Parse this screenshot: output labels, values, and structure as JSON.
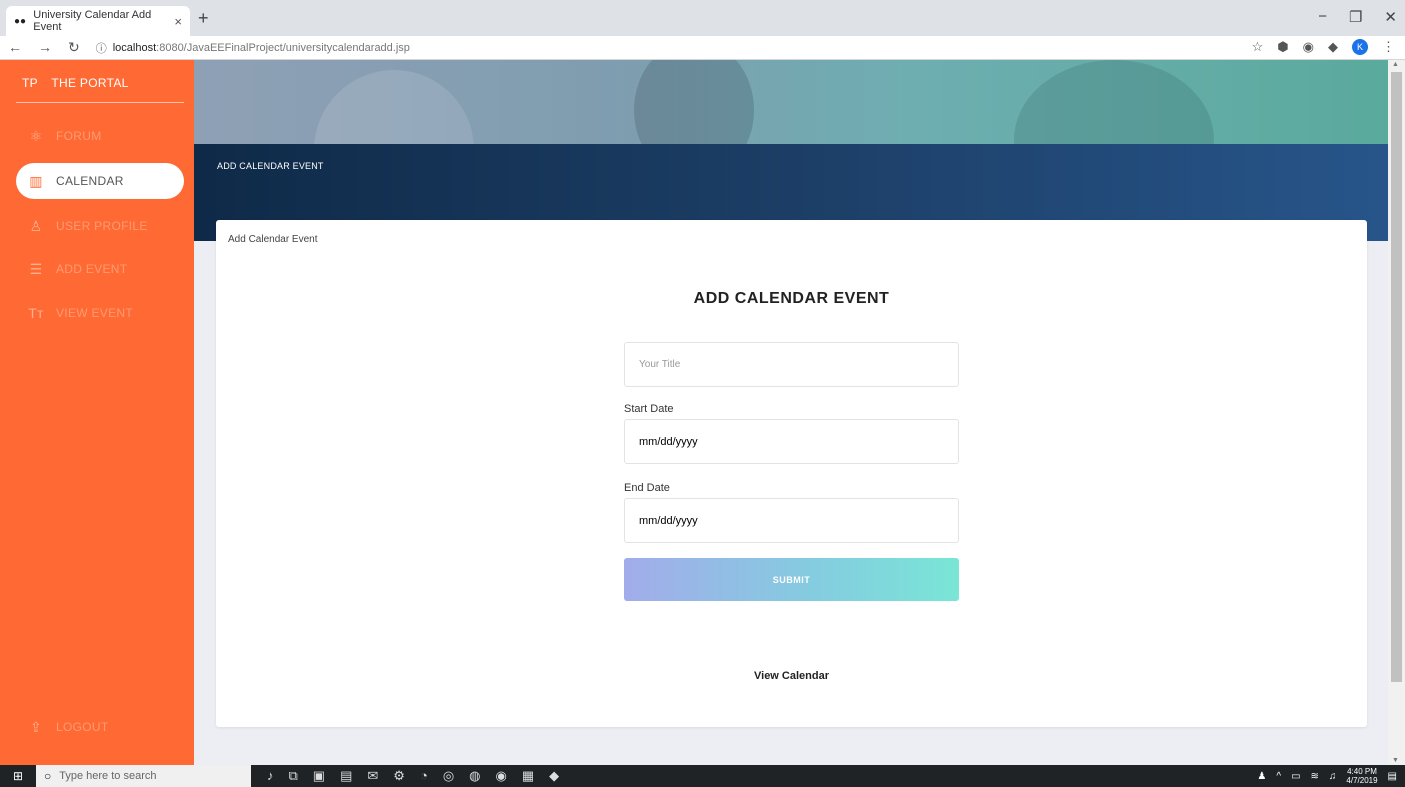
{
  "browser": {
    "tab_title": "University Calendar Add Event",
    "tab_close": "×",
    "new_tab": "+",
    "url_host": "localhost",
    "url_path": ":8080/JavaEEFinalProject/universitycalendaradd.jsp",
    "profile_initial": "K"
  },
  "sidebar": {
    "brand_short": "TP",
    "brand_name": "THE PORTAL",
    "items": [
      {
        "label": "FORUM",
        "icon": "atom-icon"
      },
      {
        "label": "CALENDAR",
        "icon": "map-icon"
      },
      {
        "label": "USER PROFILE",
        "icon": "user-icon"
      },
      {
        "label": "ADD EVENT",
        "icon": "list-icon"
      },
      {
        "label": "VIEW EVENT",
        "icon": "text-icon"
      }
    ],
    "active_index": 1,
    "logout_label": "LOGOUT",
    "accent_color": "#ff6a34"
  },
  "main": {
    "banner_title": "ADD CALENDAR EVENT",
    "card_crumb": "Add Calendar Event",
    "form_heading": "ADD CALENDAR EVENT",
    "title_placeholder": "Your Title",
    "start_label": "Start Date",
    "start_value": "mm/dd/yyyy",
    "end_label": "End Date",
    "end_value": "mm/dd/yyyy",
    "submit_label": "SUBMIT",
    "view_calendar_label": "View Calendar"
  },
  "taskbar": {
    "search_placeholder": "Type here to search",
    "time": "4:40 PM",
    "date": "4/7/2019"
  }
}
